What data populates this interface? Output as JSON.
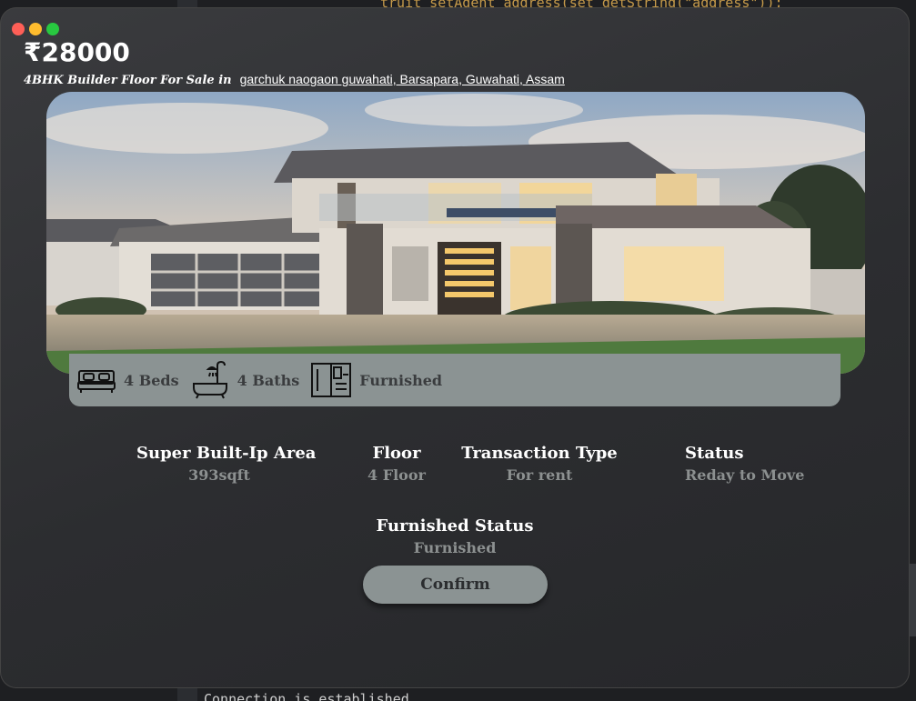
{
  "background_ide": {
    "code_top": "truit setAgent address(set getString(\"address\"));",
    "code_bottom": "Connection is established"
  },
  "listing": {
    "price": "₹28000",
    "type_line": "4BHK Builder Floor For Sale in",
    "address": "garchuk naogaon guwahati, Barsapara, Guwahati, Assam"
  },
  "features": [
    {
      "icon": "bed-icon",
      "label": "4 Beds"
    },
    {
      "icon": "bathtub-icon",
      "label": "4 Baths"
    },
    {
      "icon": "wardrobe-icon",
      "label": "Furnished"
    }
  ],
  "details": {
    "area": {
      "label": "Super Built-Ip Area",
      "value": "393sqft"
    },
    "floor": {
      "label": "Floor",
      "value": "4 Floor"
    },
    "transaction": {
      "label": "Transaction Type",
      "value": "For rent"
    },
    "status": {
      "label": "Status",
      "value": "Reday to Move"
    },
    "furnished": {
      "label": "Furnished Status",
      "value": "Furnished"
    }
  },
  "actions": {
    "confirm_label": "Confirm"
  },
  "colors": {
    "window_bg": "#2f3033",
    "accent_gray": "#8b9393",
    "muted_value": "#8c9090",
    "traffic_close": "#fe5f57",
    "traffic_min": "#febc2e",
    "traffic_max": "#28c840"
  }
}
